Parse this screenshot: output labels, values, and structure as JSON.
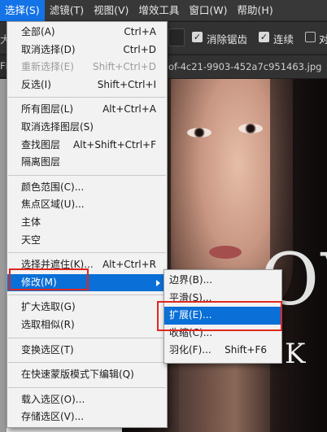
{
  "menubar": {
    "items": [
      {
        "label": "选择(S)",
        "active": true
      },
      {
        "label": "滤镜(T)"
      },
      {
        "label": "视图(V)"
      },
      {
        "label": "增效工具"
      },
      {
        "label": "窗口(W)"
      },
      {
        "label": "帮助(H)"
      }
    ]
  },
  "options": {
    "left_partial": "大",
    "anti_alias_label": "消除锯齿",
    "anti_alias_checked": true,
    "contiguous_label": "连续",
    "contiguous_checked": true,
    "sample_all_partial": "对",
    "sample_all_checked": false
  },
  "document": {
    "left_tab_partial": "FL",
    "tab_title": "of-4c21-9903-452a7c951463.jpg"
  },
  "select_menu": {
    "group1": [
      {
        "label": "全部(A)",
        "shortcut": "Ctrl+A"
      },
      {
        "label": "取消选择(D)",
        "shortcut": "Ctrl+D"
      },
      {
        "label": "重新选择(E)",
        "shortcut": "Shift+Ctrl+D",
        "disabled": true
      },
      {
        "label": "反选(I)",
        "shortcut": "Shift+Ctrl+I"
      }
    ],
    "group2": [
      {
        "label": "所有图层(L)",
        "shortcut": "Alt+Ctrl+A"
      },
      {
        "label": "取消选择图层(S)",
        "shortcut": ""
      },
      {
        "label": "查找图层",
        "shortcut": "Alt+Shift+Ctrl+F"
      },
      {
        "label": "隔离图层",
        "shortcut": ""
      }
    ],
    "group3": [
      {
        "label": "颜色范围(C)...",
        "shortcut": ""
      },
      {
        "label": "焦点区域(U)...",
        "shortcut": ""
      },
      {
        "label": "主体",
        "shortcut": ""
      },
      {
        "label": "天空",
        "shortcut": ""
      }
    ],
    "group4": [
      {
        "label": "选择并遮住(K)...",
        "shortcut": "Alt+Ctrl+R"
      },
      {
        "label": "修改(M)",
        "shortcut": "",
        "highlighted": true,
        "submenu": true
      }
    ],
    "group5": [
      {
        "label": "扩大选取(G)",
        "shortcut": ""
      },
      {
        "label": "选取相似(R)",
        "shortcut": ""
      }
    ],
    "group6": [
      {
        "label": "变换选区(T)",
        "shortcut": ""
      }
    ],
    "group7": [
      {
        "label": "在快速蒙版模式下编辑(Q)",
        "shortcut": ""
      }
    ],
    "group8": [
      {
        "label": "载入选区(O)...",
        "shortcut": ""
      },
      {
        "label": "存储选区(V)...",
        "shortcut": ""
      }
    ]
  },
  "modify_submenu": {
    "items": [
      {
        "label": "边界(B)...",
        "shortcut": ""
      },
      {
        "label": "平滑(S)...",
        "shortcut": ""
      },
      {
        "label": "扩展(E)...",
        "shortcut": "",
        "highlighted": true
      },
      {
        "label": "收缩(C)...",
        "shortcut": ""
      },
      {
        "label": "羽化(F)...",
        "shortcut": "Shift+F6"
      }
    ]
  },
  "canvas_text": {
    "big": "OV",
    "small": "K"
  },
  "colors": {
    "highlight": "#0a6fd6",
    "annotation_red": "#e0271f",
    "menubar_active": "#1473e6"
  }
}
